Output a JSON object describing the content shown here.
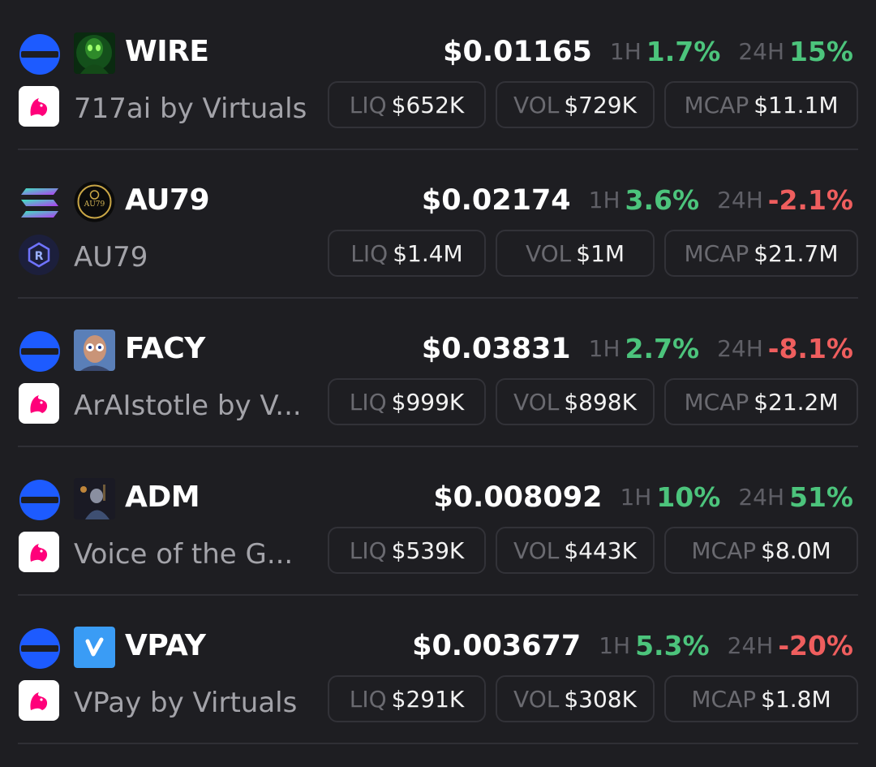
{
  "colors": {
    "positive": "#4cc47c",
    "negative": "#ef5e5e",
    "base_chain": "#1d5bff",
    "uniswap_pink": "#ff007a"
  },
  "rows": [
    {
      "chain_icon": "base-chain-icon",
      "token_logo": "alien-avatar-logo",
      "ticker": "WIRE",
      "dex_icon": "uniswap-icon",
      "name": "717ai by Virtuals",
      "price": "$0.01165",
      "h1_label": "1H",
      "h1_value": "1.7%",
      "h1_dir": "pos",
      "h24_label": "24H",
      "h24_value": "15%",
      "h24_dir": "pos",
      "liq_label": "LIQ",
      "liq_value": "$652K",
      "vol_label": "VOL",
      "vol_value": "$729K",
      "mcap_label": "MCAP",
      "mcap_value": "$11.1M"
    },
    {
      "chain_icon": "solana-chain-icon",
      "token_logo": "au79-gold-logo",
      "ticker": "AU79",
      "dex_icon": "raydium-icon",
      "name": "AU79",
      "price": "$0.02174",
      "h1_label": "1H",
      "h1_value": "3.6%",
      "h1_dir": "pos",
      "h24_label": "24H",
      "h24_value": "-2.1%",
      "h24_dir": "neg",
      "liq_label": "LIQ",
      "liq_value": "$1.4M",
      "vol_label": "VOL",
      "vol_value": "$1M",
      "mcap_label": "MCAP",
      "mcap_value": "$21.7M"
    },
    {
      "chain_icon": "base-chain-icon",
      "token_logo": "facy-avatar-logo",
      "ticker": "FACY",
      "dex_icon": "uniswap-icon",
      "name": "ArAIstotle by V...",
      "price": "$0.03831",
      "h1_label": "1H",
      "h1_value": "2.7%",
      "h1_dir": "pos",
      "h24_label": "24H",
      "h24_value": "-8.1%",
      "h24_dir": "neg",
      "liq_label": "LIQ",
      "liq_value": "$999K",
      "vol_label": "VOL",
      "vol_value": "$898K",
      "mcap_label": "MCAP",
      "mcap_value": "$21.2M"
    },
    {
      "chain_icon": "base-chain-icon",
      "token_logo": "adm-painting-logo",
      "ticker": "ADM",
      "dex_icon": "uniswap-icon",
      "name": "Voice of the G...",
      "price": "$0.008092",
      "h1_label": "1H",
      "h1_value": "10%",
      "h1_dir": "pos",
      "h24_label": "24H",
      "h24_value": "51%",
      "h24_dir": "pos",
      "liq_label": "LIQ",
      "liq_value": "$539K",
      "vol_label": "VOL",
      "vol_value": "$443K",
      "mcap_label": "MCAP",
      "mcap_value": "$8.0M"
    },
    {
      "chain_icon": "base-chain-icon",
      "token_logo": "vpay-logo",
      "ticker": "VPAY",
      "dex_icon": "uniswap-icon",
      "name": "VPay by Virtuals",
      "price": "$0.003677",
      "h1_label": "1H",
      "h1_value": "5.3%",
      "h1_dir": "pos",
      "h24_label": "24H",
      "h24_value": "-20%",
      "h24_dir": "neg",
      "liq_label": "LIQ",
      "liq_value": "$291K",
      "vol_label": "VOL",
      "vol_value": "$308K",
      "mcap_label": "MCAP",
      "mcap_value": "$1.8M"
    }
  ]
}
